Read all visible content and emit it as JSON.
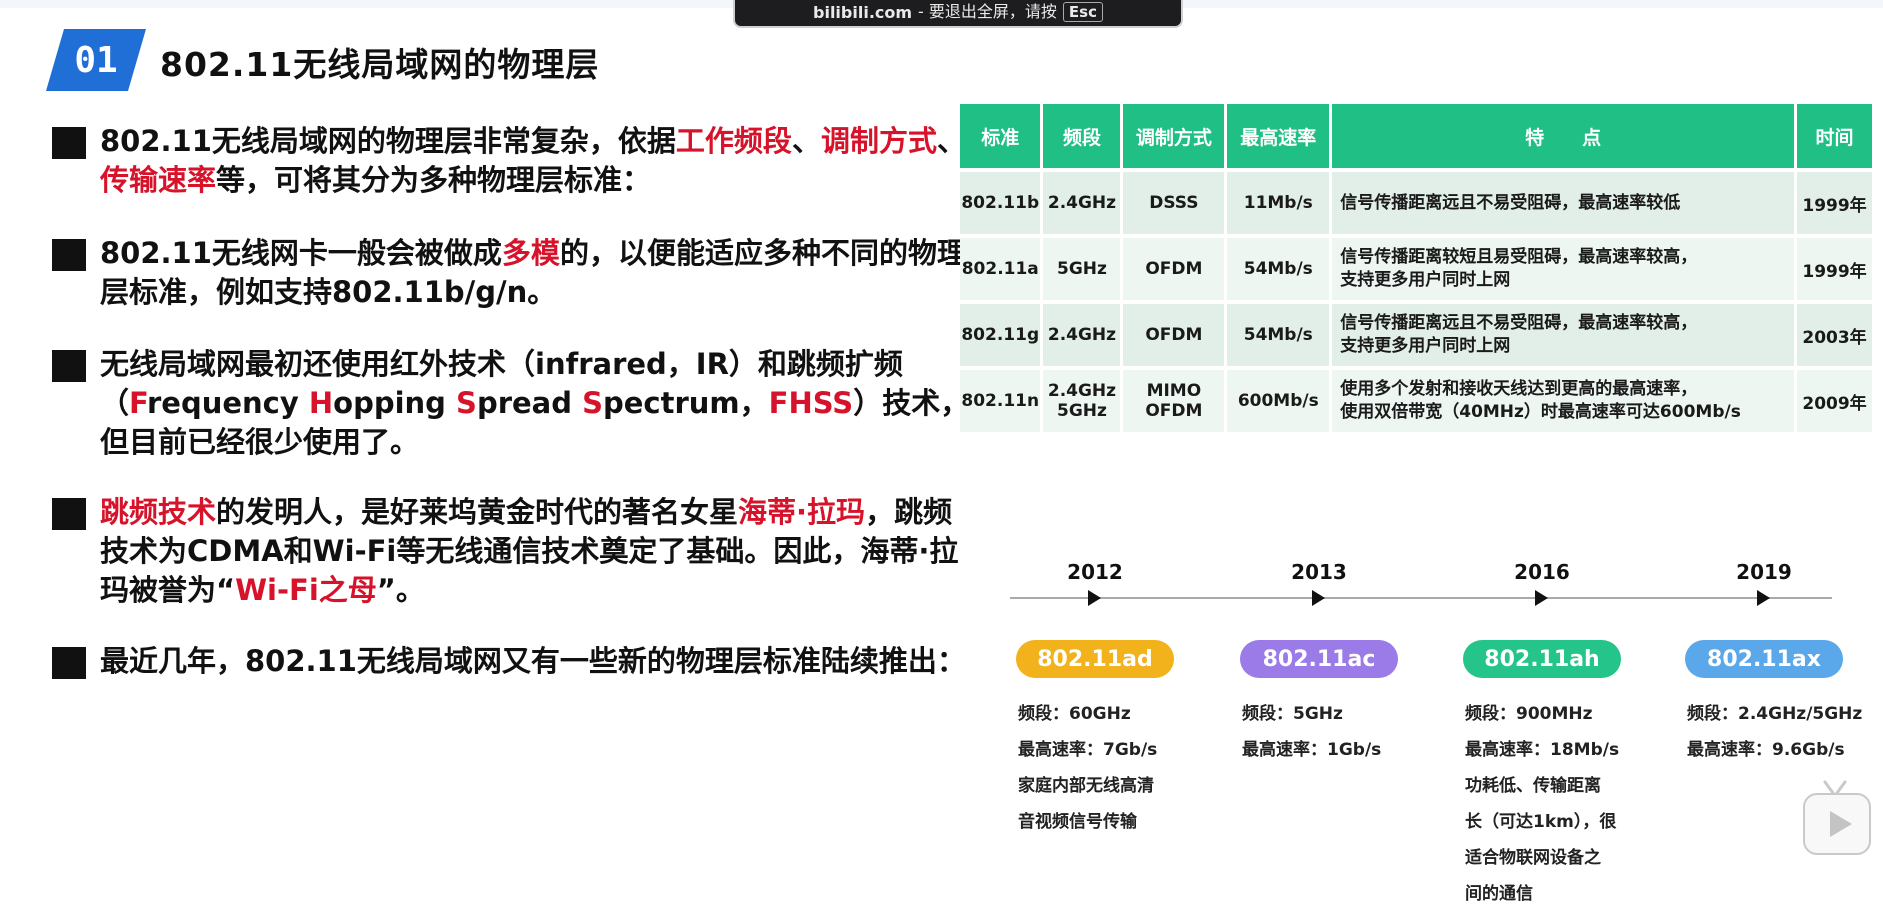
{
  "toast": {
    "site": "bilibili.com",
    "message": "- 要退出全屏，请按",
    "key": "Esc"
  },
  "header": {
    "badge_number": "01",
    "title": "802.11无线局域网的物理层"
  },
  "bullets": [
    {
      "segments": [
        {
          "text": "802.11无线局域网的物理层非常复杂，依据",
          "red": false
        },
        {
          "text": "工作频段",
          "red": true
        },
        {
          "text": "、",
          "red": false
        },
        {
          "text": "调制方式",
          "red": true
        },
        {
          "text": "、",
          "red": false
        },
        {
          "text": "传输速率",
          "red": true
        },
        {
          "text": "等，可将其分为多种物理层标准：",
          "red": false
        }
      ]
    },
    {
      "segments": [
        {
          "text": "802.11无线网卡一般会被做成",
          "red": false
        },
        {
          "text": "多模",
          "red": true
        },
        {
          "text": "的，以便能适应多种不同的物理层标准，例如支持802.11b/g/n。",
          "red": false
        }
      ]
    },
    {
      "segments": [
        {
          "text": "无线局域网最初还使用红外技术（infrared，IR）和跳频扩频（",
          "red": false
        },
        {
          "text": "F",
          "red": true
        },
        {
          "text": "requency ",
          "red": false
        },
        {
          "text": "H",
          "red": true
        },
        {
          "text": "opping ",
          "red": false
        },
        {
          "text": "S",
          "red": true
        },
        {
          "text": "pread ",
          "red": false
        },
        {
          "text": "S",
          "red": true
        },
        {
          "text": "pectrum，",
          "red": false
        },
        {
          "text": "FHSS",
          "red": true
        },
        {
          "text": "）技术，但目前已经很少使用了。",
          "red": false
        }
      ]
    },
    {
      "segments": [
        {
          "text": "跳频技术",
          "red": true
        },
        {
          "text": "的发明人，是好莱坞黄金时代的著名女星",
          "red": false
        },
        {
          "text": "海蒂·拉玛",
          "red": true
        },
        {
          "text": "，跳频技术为CDMA和Wi-Fi等无线通信技术奠定了基础。因此，海蒂·拉玛被誉为“",
          "red": false
        },
        {
          "text": "Wi-Fi之母",
          "red": true
        },
        {
          "text": "”。",
          "red": false
        }
      ]
    },
    {
      "segments": [
        {
          "text": "最近几年，802.11无线局域网又有一些新的物理层标准陆续推出：",
          "red": false
        }
      ]
    }
  ],
  "table": {
    "headers": [
      "标准",
      "频段",
      "调制方式",
      "最高速率",
      "特　　点",
      "时间"
    ],
    "rows": [
      [
        "802.11b",
        "2.4GHz",
        "DSSS",
        "11Mb/s",
        "信号传播距离远且不易受阻碍，最高速率较低",
        "1999年"
      ],
      [
        "802.11a",
        "5GHz",
        "OFDM",
        "54Mb/s",
        "信号传播距离较短且易受阻碍，最高速率较高，\n支持更多用户同时上网",
        "1999年"
      ],
      [
        "802.11g",
        "2.4GHz",
        "OFDM",
        "54Mb/s",
        "信号传播距离远且不易受阻碍，最高速率较高，\n支持更多用户同时上网",
        "2003年"
      ],
      [
        "802.11n",
        "2.4GHz\n5GHz",
        "MIMO\nOFDM",
        "600Mb/s",
        "使用多个发射和接收天线达到更高的最高速率，\n使用双倍带宽（40MHz）时最高速率可达600Mb/s",
        "2009年"
      ]
    ]
  },
  "timeline": [
    {
      "year": "2012",
      "name": "802.11ad",
      "color": "#f2b21b",
      "lines": [
        "频段：60GHz",
        "最高速率：7Gb/s",
        "家庭内部无线高清",
        "音视频信号传输"
      ]
    },
    {
      "year": "2013",
      "name": "802.11ac",
      "color": "#9a7be8",
      "lines": [
        "频段：5GHz",
        "最高速率：1Gb/s"
      ]
    },
    {
      "year": "2016",
      "name": "802.11ah",
      "color": "#25c48a",
      "lines": [
        "频段：900MHz",
        "最高速率：18Mb/s",
        "功耗低、传输距离",
        "长（可达1km），很",
        "适合物联网设备之",
        "间的通信"
      ]
    },
    {
      "year": "2019",
      "name": "802.11ax",
      "color": "#5aa7ea",
      "lines": [
        "频段：2.4GHz/5GHz",
        "最高速率：9.6Gb/s"
      ]
    }
  ]
}
